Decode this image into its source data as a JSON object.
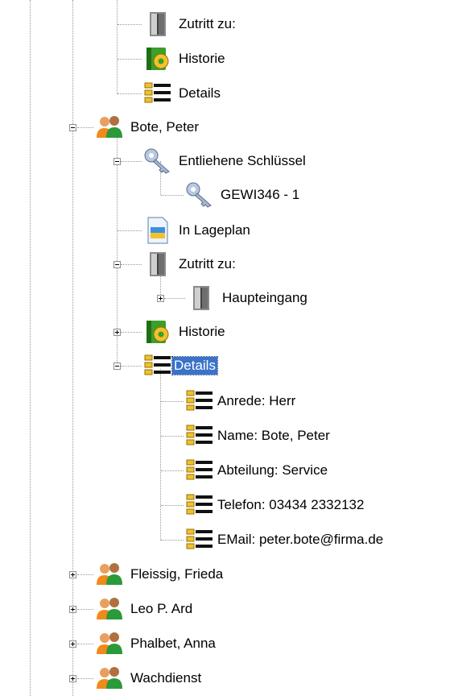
{
  "tree": {
    "nodes": [
      {
        "id": "n0",
        "label": "Zutritt zu:",
        "icon": "door-icon"
      },
      {
        "id": "n1",
        "label": "Historie",
        "icon": "history-gear-icon"
      },
      {
        "id": "n2",
        "label": "Details",
        "icon": "details-list-icon"
      },
      {
        "id": "n3",
        "label": "Bote, Peter",
        "icon": "user-group-icon",
        "expanded": true
      },
      {
        "id": "n4",
        "label": "Entliehene Schlüssel",
        "icon": "key-icon",
        "expanded": true
      },
      {
        "id": "n5",
        "label": "GEWI346 - 1",
        "icon": "key-icon"
      },
      {
        "id": "n6",
        "label": "In Lageplan",
        "icon": "floorplan-document-icon"
      },
      {
        "id": "n7",
        "label": "Zutritt zu:",
        "icon": "door-icon",
        "expanded": true
      },
      {
        "id": "n8",
        "label": "Haupteingang",
        "icon": "door-icon",
        "expanded": false
      },
      {
        "id": "n9",
        "label": "Historie",
        "icon": "history-gear-icon",
        "expanded": false
      },
      {
        "id": "n10",
        "label": "Details",
        "icon": "details-list-icon",
        "expanded": true,
        "selected": true
      },
      {
        "id": "n11",
        "label": "Anrede: Herr",
        "icon": "details-list-icon"
      },
      {
        "id": "n12",
        "label": "Name: Bote, Peter",
        "icon": "details-list-icon"
      },
      {
        "id": "n13",
        "label": "Abteilung: Service",
        "icon": "details-list-icon"
      },
      {
        "id": "n14",
        "label": "Telefon: 03434 2332132",
        "icon": "details-list-icon"
      },
      {
        "id": "n15",
        "label": "EMail: peter.bote@firma.de",
        "icon": "details-list-icon"
      },
      {
        "id": "n16",
        "label": "Fleissig, Frieda",
        "icon": "user-group-icon",
        "expanded": false
      },
      {
        "id": "n17",
        "label": "Leo P. Ard",
        "icon": "user-group-icon",
        "expanded": false
      },
      {
        "id": "n18",
        "label": "Phalbet, Anna",
        "icon": "user-group-icon",
        "expanded": false
      },
      {
        "id": "n19",
        "label": "Wachdienst",
        "icon": "user-group-icon",
        "expanded": false
      }
    ]
  },
  "colors": {
    "selection": "#3a73c9",
    "tree_lines": "#9a9a9a"
  }
}
